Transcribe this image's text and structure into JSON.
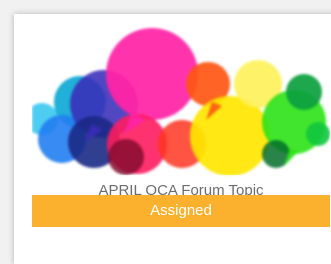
{
  "card": {
    "title": "APRIL OCA Forum Topic",
    "status_label": "Assigned",
    "image_icon": "speech-bubbles-illustration",
    "status_color": "#fbb12d"
  }
}
